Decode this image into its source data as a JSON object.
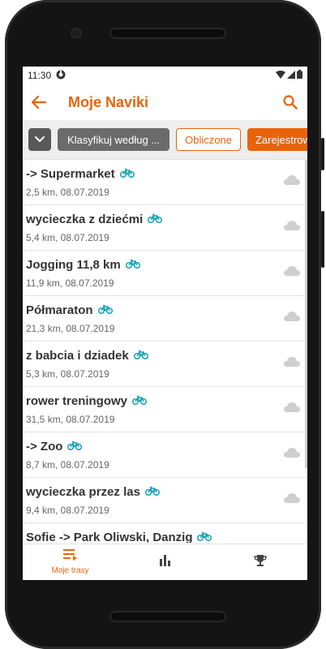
{
  "status": {
    "time": "11:30"
  },
  "toolbar": {
    "title": "Moje Naviki"
  },
  "filters": {
    "sort_label": "Klasyfikuj według ...",
    "calc_label": "Obliczone",
    "registered_label": "Zarejestrowa"
  },
  "routes": [
    {
      "name": "-> Supermarket",
      "meta": "2,5 km, 08.07.2019"
    },
    {
      "name": "wycieczka z dziećmi",
      "meta": "5,4 km, 08.07.2019"
    },
    {
      "name": "Jogging 11,8 km",
      "meta": "11,9 km, 08.07.2019"
    },
    {
      "name": "Półmaraton",
      "meta": "21,3 km, 08.07.2019"
    },
    {
      "name": "z babcia i dziadek",
      "meta": "5,3 km, 08.07.2019"
    },
    {
      "name": "rower treningowy",
      "meta": "31,5 km, 08.07.2019"
    },
    {
      "name": "-> Zoo",
      "meta": "8,7 km, 08.07.2019"
    },
    {
      "name": "wycieczka przez las",
      "meta": "9,4 km, 08.07.2019"
    },
    {
      "name": "Sofie -> Park Oliwski, Danzig",
      "meta": ""
    }
  ],
  "bottom_nav": {
    "routes_label": "Moje trasy"
  },
  "colors": {
    "accent": "#e8640c",
    "bike_icon": "#1aa3b8"
  },
  "icons": {
    "back": "arrow-left-icon",
    "search": "search-icon",
    "dropdown": "chevron-down-icon",
    "bike": "bicycle-icon",
    "cloud": "cloud-icon",
    "nav_routes": "list-icon",
    "nav_stats": "bar-chart-icon",
    "nav_trophy": "trophy-icon"
  }
}
